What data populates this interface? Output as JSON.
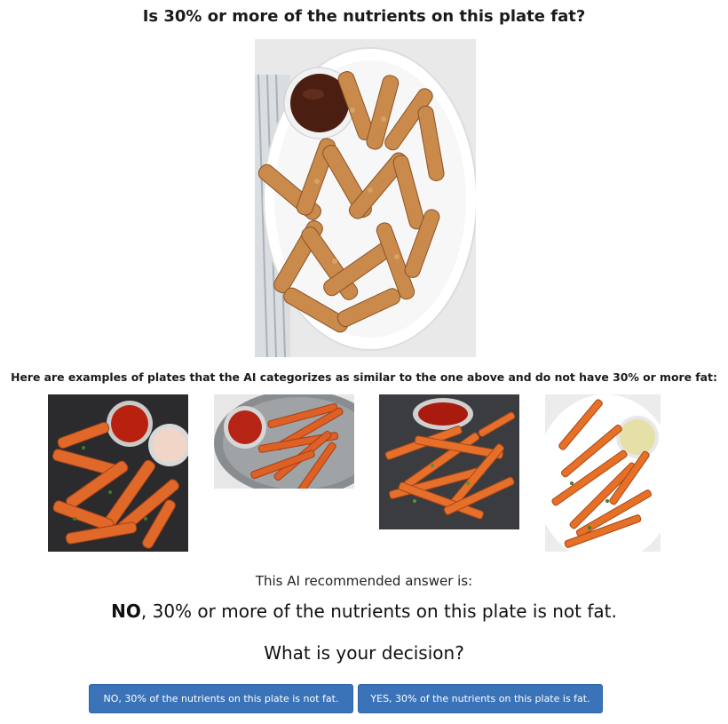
{
  "question": "Is 30% or more of the nutrients on this plate fat?",
  "main_image": {
    "description_icon": "churros-plate-image"
  },
  "examples_caption": "Here are examples of plates that the AI categorizes as similar to the one above and do not have 30% or more fat:",
  "examples": [
    {
      "icon": "sweet-potato-wedges-image"
    },
    {
      "icon": "sweet-potato-fries-image"
    },
    {
      "icon": "sweet-potato-fries-image"
    },
    {
      "icon": "sweet-potato-fries-image"
    }
  ],
  "recommendation": {
    "label": "This AI recommended answer is:",
    "answer_bold": "NO",
    "answer_rest": ", 30% or more of the nutrients on this plate is not fat."
  },
  "decision_prompt": "What is your decision?",
  "buttons": {
    "no": "NO, 30% of the nutrients on this plate is not fat.",
    "yes": "YES, 30% of the nutrients on this plate is fat."
  },
  "colors": {
    "button_bg": "#3a73b8",
    "churro": "#c98a4b",
    "fries": "#e0692a"
  }
}
